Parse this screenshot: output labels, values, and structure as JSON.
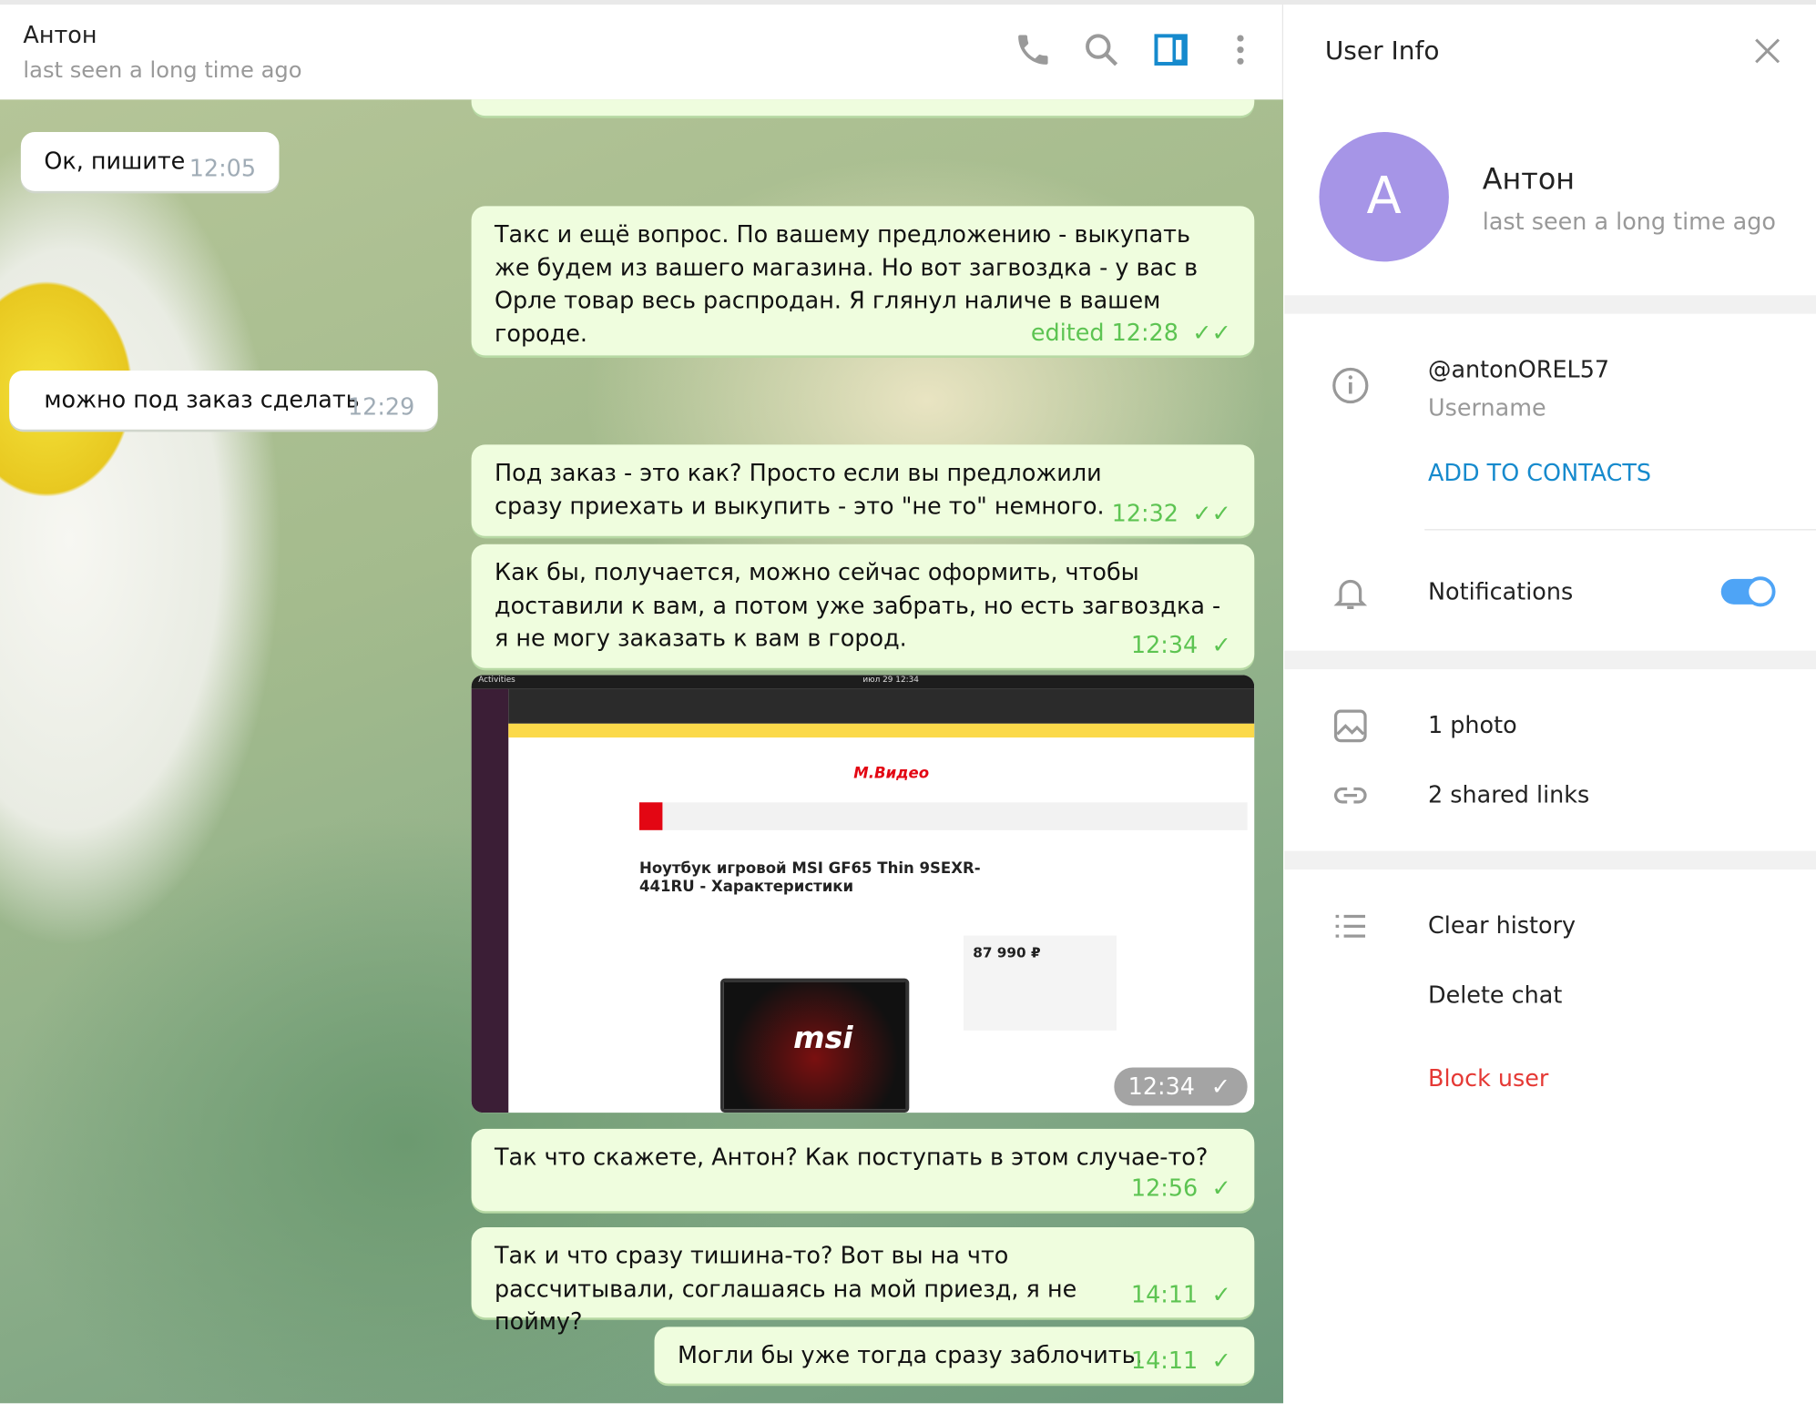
{
  "header": {
    "title": "Антон",
    "status": "last seen a long time ago",
    "icons": [
      "phone-icon",
      "search-icon",
      "sidebar-toggle-icon",
      "more-vertical-icon"
    ]
  },
  "messages": [
    {
      "dir": "in",
      "text": "Ок, пишите",
      "time": "12:05"
    },
    {
      "dir": "out",
      "text": "Такс и ещё вопрос. По вашему предложению - выкупать же будем из вашего магазина. Но вот загвоздка - у вас в Орле товар весь распродан. Я глянул наличе в вашем городе.",
      "time": "edited 12:28",
      "status": "read"
    },
    {
      "dir": "in",
      "text": "можно под заказ сделать",
      "time": "12:29"
    },
    {
      "dir": "out",
      "text": "Под заказ - это как? Просто если вы предложили сразу приехать и выкупить - это \"не то\" немного.",
      "time": "12:32",
      "status": "read"
    },
    {
      "dir": "out",
      "text": "Как бы, получается, можно сейчас оформить, чтобы доставили к вам, а потом уже забрать, но есть загвоздка - я не могу заказать к вам в город.",
      "time": "12:34",
      "status": "sent"
    },
    {
      "dir": "out",
      "type": "photo",
      "time": "12:34",
      "status": "sent",
      "photo": {
        "title": "Ноутбук игровой MSI GF65 Thin 9SEXR-441RU - Характеристики",
        "price": "87 990 ₽",
        "brand": "msi",
        "site": "М.Видео",
        "topbar": "Activities",
        "clock": "июл 29 12:34"
      }
    },
    {
      "dir": "out",
      "text": "Так что скажете, Антон? Как поступать в этом случае-то?",
      "time": "12:56",
      "status": "sent"
    },
    {
      "dir": "out",
      "text": "Так и что сразу тишина-то? Вот вы на что рассчитывали, соглашаясь на мой приезд, я не пойму?",
      "time": "14:11",
      "status": "sent"
    },
    {
      "dir": "out",
      "text": "Могли бы уже тогда сразу заблочить.",
      "time": "14:11",
      "status": "sent"
    }
  ],
  "panel": {
    "title": "User Info",
    "avatar_letter": "А",
    "avatar_color": "#a695e7",
    "name": "Антон",
    "status": "last seen a long time ago",
    "username": "@antonOREL57",
    "username_label": "Username",
    "add_contacts": "ADD TO CONTACTS",
    "notifications": "Notifications",
    "notifications_on": true,
    "photos": "1 photo",
    "links": "2 shared links",
    "clear_history": "Clear history",
    "delete_chat": "Delete chat",
    "block_user": "Block user"
  },
  "colors": {
    "accent": "#168acd",
    "outgoing": "#effdde",
    "check": "#5dc452",
    "danger": "#e53935"
  }
}
